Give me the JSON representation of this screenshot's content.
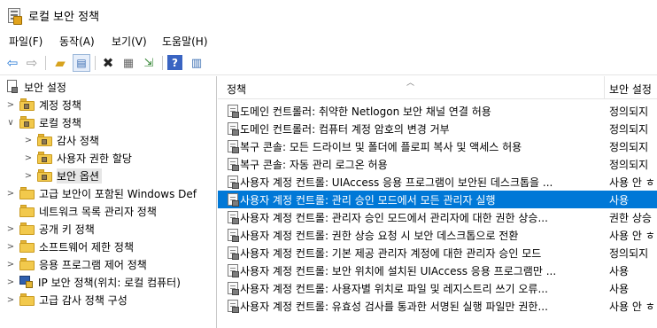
{
  "window": {
    "title": "로컬 보안 정책"
  },
  "menu": [
    "파일(F)",
    "동작(A)",
    "보기(V)",
    "도움말(H)"
  ],
  "toolbar": {
    "icons": [
      "back-icon",
      "forward-icon",
      "up-folder-icon",
      "show-hide-tree-icon",
      "delete-icon",
      "properties-icon",
      "export-list-icon",
      "help-icon",
      "view-icon"
    ]
  },
  "tree": {
    "root": "보안 설정",
    "items": [
      {
        "label": "계정 정책",
        "level": 1,
        "expanded": false
      },
      {
        "label": "로컬 정책",
        "level": 1,
        "expanded": true
      },
      {
        "label": "감사 정책",
        "level": 2,
        "expanded": false
      },
      {
        "label": "사용자 권한 할당",
        "level": 2,
        "expanded": false
      },
      {
        "label": "보안 옵션",
        "level": 2,
        "expanded": false,
        "selected": true
      },
      {
        "label": "고급 보안이 포함된 Windows Def",
        "level": 1,
        "expanded": false
      },
      {
        "label": "네트워크 목록 관리자 정책",
        "level": 1
      },
      {
        "label": "공개 키 정책",
        "level": 1,
        "expanded": false
      },
      {
        "label": "소프트웨어 제한 정책",
        "level": 1,
        "expanded": false
      },
      {
        "label": "응용 프로그램 제어 정책",
        "level": 1,
        "expanded": false
      },
      {
        "label": "IP 보안 정책(위치: 로컬 컴퓨터)",
        "level": 1
      },
      {
        "label": "고급 감사 정책 구성",
        "level": 1,
        "expanded": false
      }
    ]
  },
  "list": {
    "columns": [
      "정책",
      "보안 설정"
    ],
    "rows": [
      {
        "policy": "도메인 컨트롤러: 취약한 Netlogon 보안 채널 연결 허용",
        "setting": "정의되지"
      },
      {
        "policy": "도메인 컨트롤러: 컴퓨터 계정 암호의 변경 거부",
        "setting": "정의되지"
      },
      {
        "policy": "복구 콘솔: 모든 드라이브 및 폴더에 플로피 복사 및 액세스 허용",
        "setting": "정의되지"
      },
      {
        "policy": "복구 콘솔: 자동 관리 로그온 허용",
        "setting": "정의되지"
      },
      {
        "policy": "사용자 계정 컨트롤: UIAccess 응용 프로그램이 보안된 데스크톱을 ...",
        "setting": "사용 안 ㅎ"
      },
      {
        "policy": "사용자 계정 컨트롤: 관리 승인 모드에서 모든 관리자 실행",
        "setting": "사용",
        "selected": true
      },
      {
        "policy": "사용자 계정 컨트롤: 관리자 승인 모드에서 관리자에 대한 권한 상승...",
        "setting": "권한 상승"
      },
      {
        "policy": "사용자 계정 컨트롤: 권한 상승 요청 시 보안 데스크톱으로 전환",
        "setting": "사용 안 ㅎ"
      },
      {
        "policy": "사용자 계정 컨트롤: 기본 제공 관리자 계정에 대한 관리자 승인 모드",
        "setting": "정의되지"
      },
      {
        "policy": "사용자 계정 컨트롤: 보안 위치에 설치된 UIAccess 응용 프로그램만 ...",
        "setting": "사용"
      },
      {
        "policy": "사용자 계정 컨트롤: 사용자별 위치로 파일 및 레지스트리 쓰기 오류...",
        "setting": "사용"
      },
      {
        "policy": "사용자 계정 컨트롤: 유효성 검사를 통과한 서명된 실행 파일만 권한...",
        "setting": "사용 안 ㅎ"
      }
    ]
  },
  "colors": {
    "selection": "#0078d7",
    "tree_selection": "#e6e6e6",
    "folder": "#f2c94c"
  }
}
